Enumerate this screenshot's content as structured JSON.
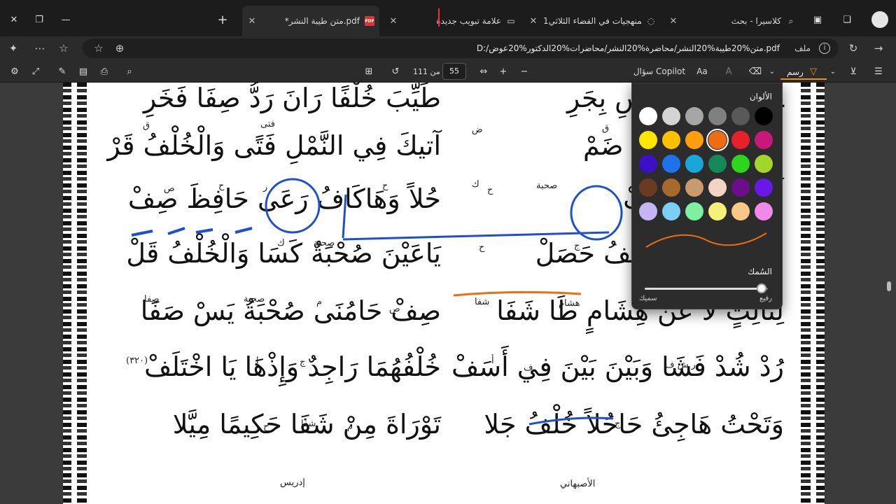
{
  "tabs": [
    {
      "label": "*متن طيبة النشر.pdf",
      "icon": "pdf-icon",
      "active": true
    },
    {
      "label": "علامة تبويب جديدة",
      "icon": "new-tab-icon",
      "active": false
    },
    {
      "label": "المنهجيات في الفضاء الثلاثي1",
      "icon": "loading-icon",
      "active": false
    },
    {
      "label": "كلاسيرا - بحث",
      "icon": "search-icon",
      "active": false
    }
  ],
  "address": {
    "prefix": "ملف",
    "url": "D:/متن%20طيبة%20النشر/محاضرة%20النشر/محاضرات%20الدكتور%20عوض.pdf"
  },
  "pdf_toolbar": {
    "draw_label": "رسم",
    "copilot_label": "سؤال Copilot",
    "page_current": "55",
    "page_total_label": "من 111",
    "zoom_out": "−",
    "zoom_in": "+"
  },
  "document": {
    "verses": [
      {
        "right": "ـ الرَّافِتي النَّاسِ بِجَرِ",
        "left": "طَيِّبَ خُلْفًا رَانَ رَدُّ صِفَا فَخَرِ"
      },
      {
        "right": "فًا قَامَ بِالْخُلْفِ ضَمْ",
        "left": "آتيكَ فِي النَّمْلِ فَتًى وَالْخُلْفُ قَرْ"
      },
      {
        "right": "أَمِلَ صُحْبَةٌ كَفْ",
        "left": "حُلاً وَهَاكَافُ رَعَى حَافِظَ صِفْ"
      },
      {
        "right": "صُحْبَةُ جَنَا الْخُلْفُ حَصَلْ",
        "left": "يَاعَيْنَ صُحْبَةٌ كَسَا وَالْخُلْفُ قَلْ"
      },
      {
        "right": "لِثَالِثٍ لَا عَنْ هِشَامٍ طَا شَفَا",
        "left": "صِفْ حَامُنَى صُحْبَةُ يَسْ صَفَا"
      },
      {
        "right": "رُدْ شُدْ فَشَا وَبَيْنَ بَيْنَ فِي أَسَفْ",
        "left": "خُلْفُهُمَا رَاجِدٌ وَإِذْهَا يَا اخْتَلَفْ"
      },
      {
        "right": "وَتَحْتُ هَاجِئُ حَاحُلاً خُلْفُ جَلا",
        "left": "تَوْرَاةَ مِنْ شَفَا حَكِيمًا مِيَّلا"
      }
    ],
    "annotations": [
      {
        "text": "ق",
        "pos": "a1"
      },
      {
        "text": "ض",
        "pos": "a2"
      },
      {
        "text": "فتى",
        "pos": "a3"
      },
      {
        "text": "ق",
        "pos": "a4"
      },
      {
        "text": "ك",
        "pos": "a5"
      },
      {
        "text": "صحبة",
        "pos": "a6"
      },
      {
        "text": "ح",
        "pos": "a7"
      },
      {
        "text": "ح",
        "pos": "a8"
      },
      {
        "text": "ر",
        "pos": "a9"
      },
      {
        "text": "ص",
        "pos": "a10"
      },
      {
        "text": "ح",
        "pos": "a11"
      },
      {
        "text": "صحبة",
        "pos": "a12"
      },
      {
        "text": "ك",
        "pos": "a13"
      },
      {
        "text": "ج",
        "pos": "a14"
      },
      {
        "text": "ح",
        "pos": "a15"
      },
      {
        "text": "هشام",
        "pos": "a16"
      },
      {
        "text": "شفا",
        "pos": "a17"
      },
      {
        "text": "صفا",
        "pos": "a18"
      },
      {
        "text": "صحبة",
        "pos": "a19"
      },
      {
        "text": "م",
        "pos": "a20"
      },
      {
        "text": "ص",
        "pos": "a21"
      },
      {
        "text": "(٣٢٠)",
        "pos": "a22"
      },
      {
        "text": "ر ش ف",
        "pos": "a23"
      },
      {
        "text": "أ",
        "pos": "a24"
      },
      {
        "text": "ف",
        "pos": "a25"
      },
      {
        "text": "ج",
        "pos": "a26"
      },
      {
        "text": "إ",
        "pos": "a27"
      },
      {
        "text": "ج",
        "pos": "a28"
      },
      {
        "text": "شفا",
        "pos": "a29"
      },
      {
        "text": "م",
        "pos": "a30"
      },
      {
        "text": "ح",
        "pos": "a31"
      },
      {
        "text": "الأصبهاني",
        "pos": "a32"
      },
      {
        "text": "إدريس",
        "pos": "a33"
      }
    ]
  },
  "ink_palette": {
    "title": "الألوان",
    "colors": [
      "#ffffff",
      "#d4d4d4",
      "#a6a6a6",
      "#808080",
      "#595959",
      "#000000",
      "#ffe600",
      "#ffc000",
      "#ff9f0f",
      "#ec6d13",
      "#e8202a",
      "#c8197a",
      "#3c10c6",
      "#1e72ec",
      "#1aa6d8",
      "#13885a",
      "#2bd61c",
      "#a3d62b",
      "#6a3a23",
      "#a86a2c",
      "#c89a6e",
      "#f3d3c1",
      "#6a0e8c",
      "#6a18e8",
      "#c5b5f5",
      "#7ccef5",
      "#7ef0a0",
      "#f5f07a",
      "#f8c888",
      "#f089e8"
    ],
    "selected_index": 9,
    "thickness_title": "السُمك",
    "thickness_min": "رفيع",
    "thickness_max": "سميك",
    "thickness_value": 0.95,
    "preview_color": "#ec6d13"
  }
}
